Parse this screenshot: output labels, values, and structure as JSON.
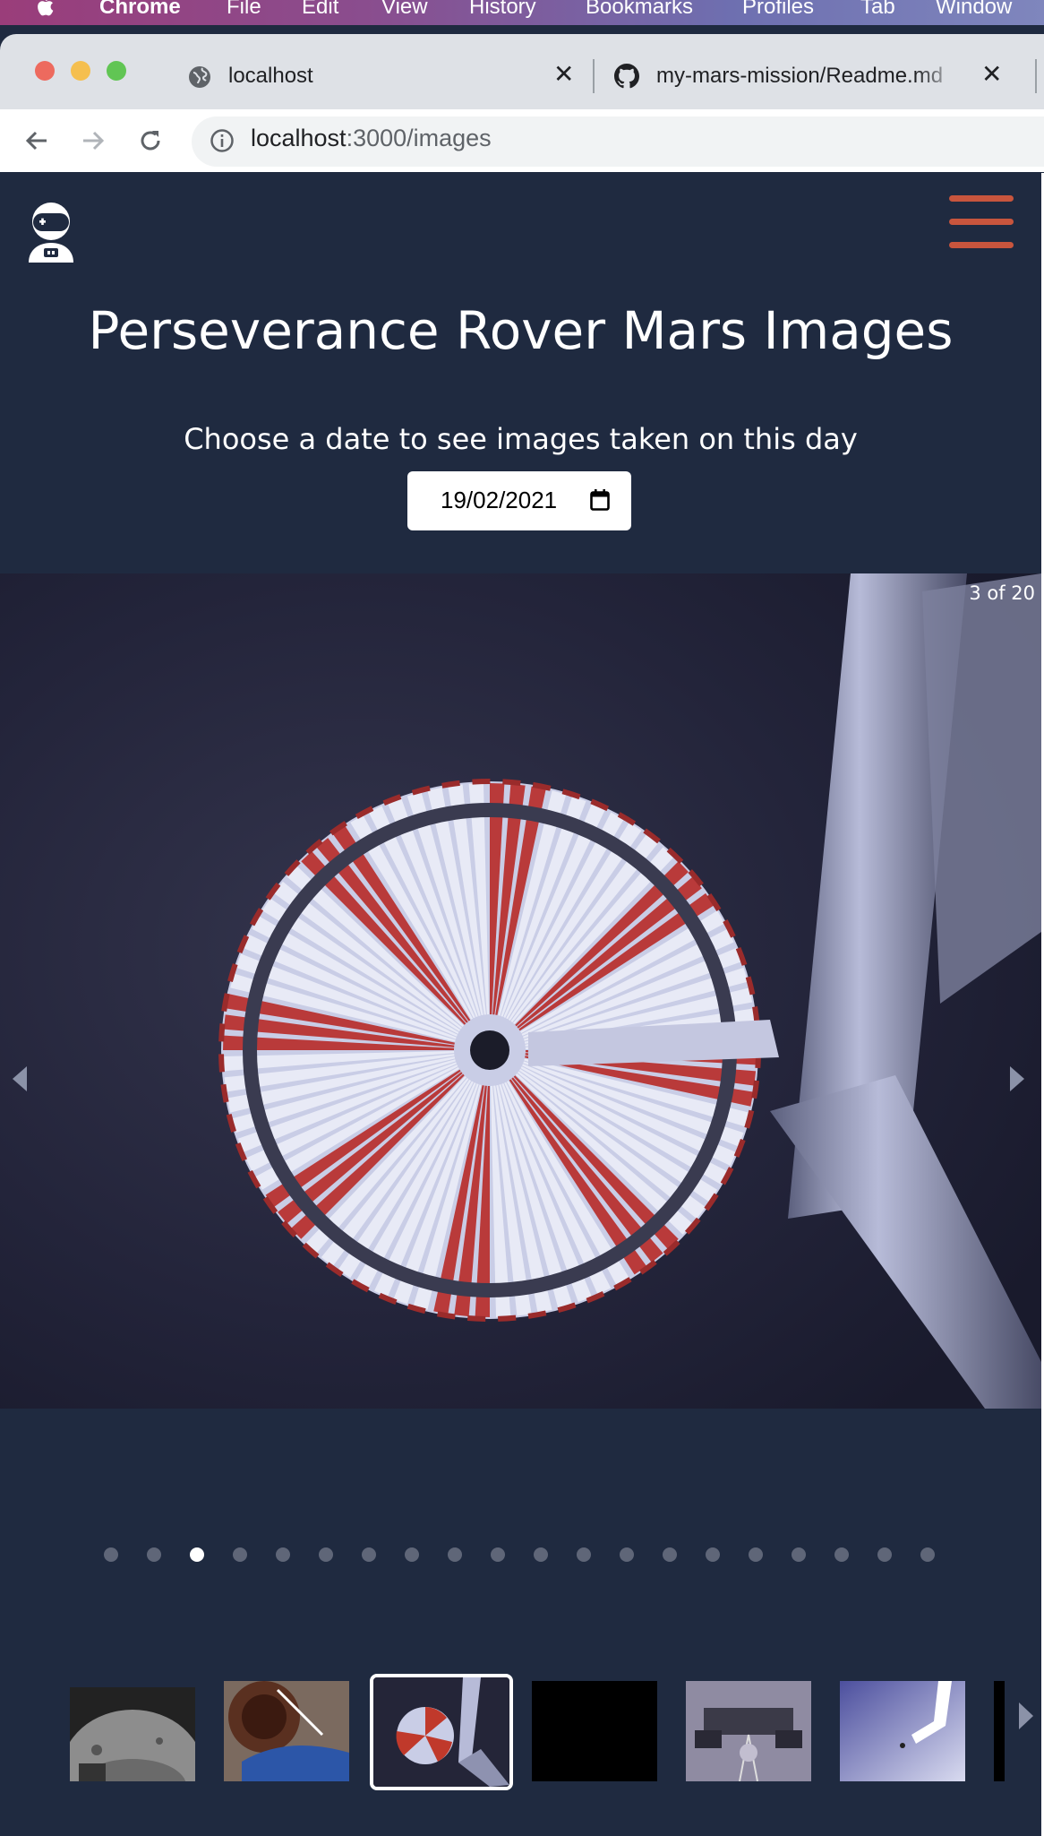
{
  "menubar": {
    "app": "Chrome",
    "items": [
      "File",
      "Edit",
      "View",
      "History",
      "Bookmarks",
      "Profiles",
      "Tab",
      "Window"
    ]
  },
  "tabs": [
    {
      "title": "localhost",
      "icon": "globe-icon",
      "active": true
    },
    {
      "title": "my-mars-mission/Readme.md",
      "icon": "github-icon",
      "active": false
    }
  ],
  "toolbar": {
    "url_host": "localhost",
    "url_path": ":3000/images"
  },
  "page": {
    "title": "Perseverance Rover Mars Images",
    "subtitle": "Choose a date to see images taken on this day",
    "date_value": "19/02/2021",
    "counter": "3 of 20",
    "total_images": 20,
    "current_index": 3
  },
  "thumbnails": [
    {
      "name": "thumb-mars-ground"
    },
    {
      "name": "thumb-rover-wheel"
    },
    {
      "name": "thumb-parachute",
      "selected": true
    },
    {
      "name": "thumb-black"
    },
    {
      "name": "thumb-descent-stage"
    },
    {
      "name": "thumb-sky-crane"
    },
    {
      "name": "thumb-partial"
    }
  ],
  "colors": {
    "page_bg": "#1f2a40",
    "accent": "#c8553d",
    "dot_inactive": "#5f6678",
    "dot_active": "#ffffff"
  }
}
